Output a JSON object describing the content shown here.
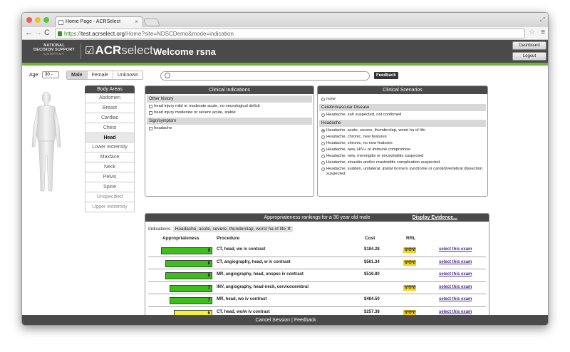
{
  "browser": {
    "tab_title": "Home Page - ACRSelect",
    "url_scheme": "https://",
    "url_host": "test.acrselect.org",
    "url_path": "/Home?site=NDSCDemo&mode=indication"
  },
  "header": {
    "nds_line1": "NATIONAL",
    "nds_line2": "DECISION SUPPORT",
    "nds_line3": "COMPANY",
    "logo_bold": "ACR",
    "logo_light": "select",
    "welcome": "Welcome rsna",
    "dashboard_label": "Dashboard",
    "logout_label": "Logout"
  },
  "patient": {
    "age_label": "Age:",
    "age_value": "30",
    "sexes": [
      "Male",
      "Female",
      "Unknown"
    ],
    "selected_sex": "Male",
    "feedback_label": "Feedback"
  },
  "body_areas": {
    "title": "Body Areas",
    "items": [
      "Abdomen",
      "Breast",
      "Cardiac",
      "Chest",
      "Head",
      "Lower extremity",
      "Maxface",
      "Neck",
      "Pelvis",
      "Spine",
      "Unspecified",
      "Upper extremity"
    ],
    "selected": "Head"
  },
  "clinical_indications": {
    "title": "Clinical Indications",
    "group1": "Other history",
    "g1_items": [
      "head injury mild or moderate acute, no neurological deficit",
      "head injury moderate or severe acute, stable"
    ],
    "group2": "Sign/symptom",
    "g2_items": [
      "headache"
    ]
  },
  "clinical_scenarios": {
    "title": "Clinical Scenarios",
    "none_label": "none",
    "group1": "Cerebrovascular Disease",
    "g1_items": [
      "Headache, sah suspected, not confirmed"
    ],
    "group2": "Headache",
    "g2_items": [
      "Headache, acute, severe, thunderclap, worst ha of life",
      "Headache, chronic, new features",
      "Headache, chronic, no new features",
      "Headache, new, HIV+ or immune compromise",
      "Headache, new, meningitis or encephalitis suspected",
      "Headache, sinusitis and/or mastoiditis complication suspected",
      "Headache, sudden, unilateral, ipsilat horners syndrome or carotid/vertebral dissection suspected"
    ],
    "selected_index": 0
  },
  "rankings": {
    "title": "Appropriateness rankings for a 30 year old male",
    "display_evidence": "Display Evidence...",
    "indications_label": "Indications:",
    "indication_chip": "Headache, acute, severe, thunderclap, worst ha of life",
    "col_appropriateness": "Appropriateness",
    "col_procedure": "Procedure",
    "col_cost": "Cost",
    "col_rrl": "RRL",
    "select_label": "select this exam",
    "rows": [
      {
        "score": "9",
        "score_val": 9,
        "procedure": "CT, head, wo iv contrast",
        "cost": "$184.28",
        "rrl": "☢☢☢",
        "color": "#3cbf1a"
      },
      {
        "score": "8",
        "score_val": 8,
        "procedure": "CT, angiography, head, w iv contrast",
        "cost": "$561.34",
        "rrl": "☢☢☢",
        "color": "#3cbf1a"
      },
      {
        "score": "8",
        "score_val": 8,
        "procedure": "MR, angiography, head, unspec iv contrast",
        "cost": "$516.80",
        "rrl": "",
        "color": "#3cbf1a"
      },
      {
        "score": "7",
        "score_val": 7,
        "procedure": "INV, angiography, head-neck, cervicocerebral",
        "cost": "",
        "rrl": "☢☢☢",
        "color": "#3cbf1a"
      },
      {
        "score": "7",
        "score_val": 7,
        "procedure": "MR, head, wo iv contrast",
        "cost": "$484.50",
        "rrl": "",
        "color": "#3cbf1a"
      },
      {
        "score": "6",
        "score_val": 6,
        "procedure": "CT, head, wo/w iv contrast",
        "cost": "$257.38",
        "rrl": "☢☢☢",
        "color": "#f2f23a"
      }
    ]
  },
  "footer": {
    "cancel": "Cancel Session",
    "divider": "|",
    "feedback": "Feedback"
  }
}
